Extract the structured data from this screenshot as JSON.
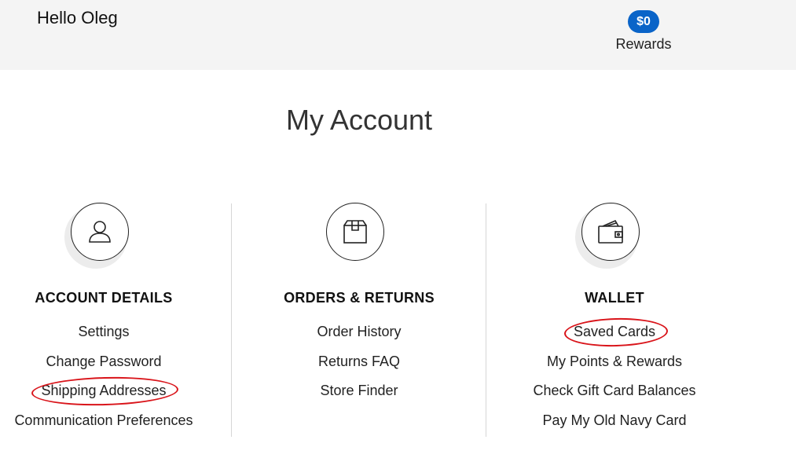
{
  "header": {
    "greeting": "Hello Oleg",
    "rewards_amount": "$0",
    "rewards_label": "Rewards"
  },
  "page_title": "My Account",
  "columns": [
    {
      "icon": "user-icon",
      "heading": "ACCOUNT DETAILS",
      "links": [
        "Settings",
        "Change Password",
        "Shipping Addresses",
        "Communication Preferences"
      ]
    },
    {
      "icon": "box-icon",
      "heading": "ORDERS & RETURNS",
      "links": [
        "Order History",
        "Returns FAQ",
        "Store Finder"
      ]
    },
    {
      "icon": "wallet-icon",
      "heading": "WALLET",
      "links": [
        "Saved Cards",
        "My Points & Rewards",
        "Check Gift Card Balances",
        "Pay My Old Navy Card"
      ]
    }
  ],
  "annotation_color": "#d9141a",
  "accent_color": "#0a64c8"
}
